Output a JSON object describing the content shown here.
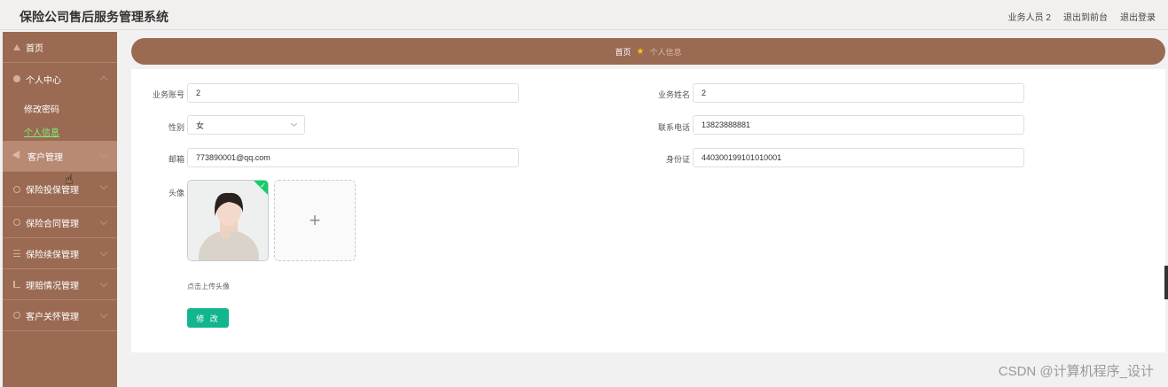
{
  "header": {
    "title": "保险公司售后服务管理系统",
    "user": "业务人员 2",
    "back_front": "退出到前台",
    "logout": "退出登录"
  },
  "sidebar": {
    "home": "首页",
    "personal_center": "个人中心",
    "change_password": "修改密码",
    "personal_info": "个人信息",
    "customer_mgmt": "客户管理",
    "insurance_apply": "保险投保管理",
    "insurance_contract": "保险合同管理",
    "insurance_renewal": "保险续保管理",
    "claims": "理赔情况管理",
    "customer_care": "客户关怀管理"
  },
  "breadcrumb": {
    "home": "首页",
    "current": "个人信息"
  },
  "form": {
    "account_label": "业务账号",
    "account_value": "2",
    "name_label": "业务姓名",
    "name_value": "2",
    "gender_label": "性别",
    "gender_value": "女",
    "phone_label": "联系电话",
    "phone_value": "13823888881",
    "email_label": "邮箱",
    "email_value": "773890001@qq.com",
    "id_label": "身份证",
    "id_value": "440300199101010001",
    "avatar_label": "头像",
    "upload_hint": "点击上传头像",
    "upload_plus": "+",
    "submit": "修 改"
  },
  "watermark": "CSDN @计算机程序_设计",
  "colors": {
    "sidebar_bg": "#9b6a52",
    "accent_green": "#13b58e",
    "active_link": "#7cf07c"
  }
}
